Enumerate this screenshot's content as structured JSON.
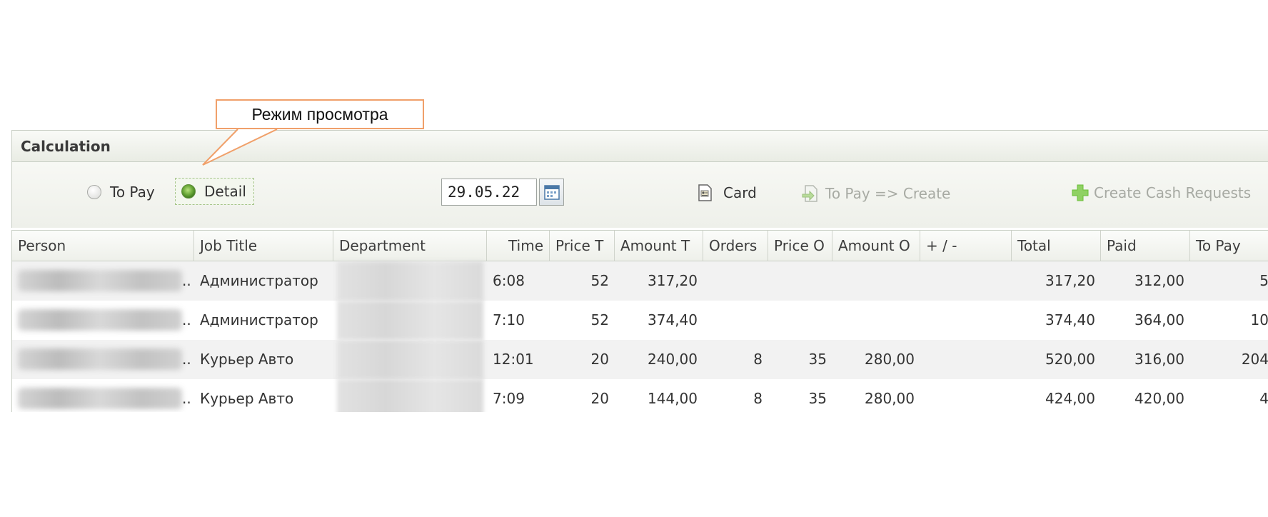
{
  "callout": {
    "text": "Режим просмотра"
  },
  "panel": {
    "title": "Calculation",
    "mode_options": [
      {
        "label": "To Pay",
        "selected": false
      },
      {
        "label": "Detail",
        "selected": true
      }
    ],
    "date_value": "29.05.22",
    "card_label": "Card",
    "to_pay_create_label": "To Pay => Create",
    "create_cash_label": "Create Cash Requests"
  },
  "table": {
    "columns": [
      "Person",
      "Job Title",
      "Department",
      "Time",
      "Price T",
      "Amount T",
      "Orders",
      "Price O",
      "Amount O",
      "+ / -",
      "Total",
      "Paid",
      "To Pay"
    ],
    "rows": [
      {
        "person_suffix": "..",
        "job_title": "Администратор",
        "time": "6:08",
        "price_t": "52",
        "amount_t": "317,20",
        "orders": "",
        "price_o": "",
        "amount_o": "",
        "adjust": "",
        "total": "317,20",
        "paid": "312,00",
        "to_pay": "5"
      },
      {
        "person_suffix": "..",
        "job_title": "Администратор",
        "time": "7:10",
        "price_t": "52",
        "amount_t": "374,40",
        "orders": "",
        "price_o": "",
        "amount_o": "",
        "adjust": "",
        "total": "374,40",
        "paid": "364,00",
        "to_pay": "10"
      },
      {
        "person_suffix": "..",
        "job_title": "Курьер Авто",
        "time": "12:01",
        "price_t": "20",
        "amount_t": "240,00",
        "orders": "8",
        "price_o": "35",
        "amount_o": "280,00",
        "adjust": "",
        "total": "520,00",
        "paid": "316,00",
        "to_pay": "204"
      },
      {
        "person_suffix": "..",
        "job_title": "Курьер Авто",
        "time": "7:09",
        "price_t": "20",
        "amount_t": "144,00",
        "orders": "8",
        "price_o": "35",
        "amount_o": "280,00",
        "adjust": "",
        "total": "424,00",
        "paid": "420,00",
        "to_pay": "4"
      }
    ]
  },
  "colors": {
    "callout_border": "#f0a06a",
    "header_bg": "#e9ece4",
    "row_alt_bg": "#f2f2f2",
    "selected_radio": "#6aa838",
    "plus_icon": "#6bbf3a"
  }
}
